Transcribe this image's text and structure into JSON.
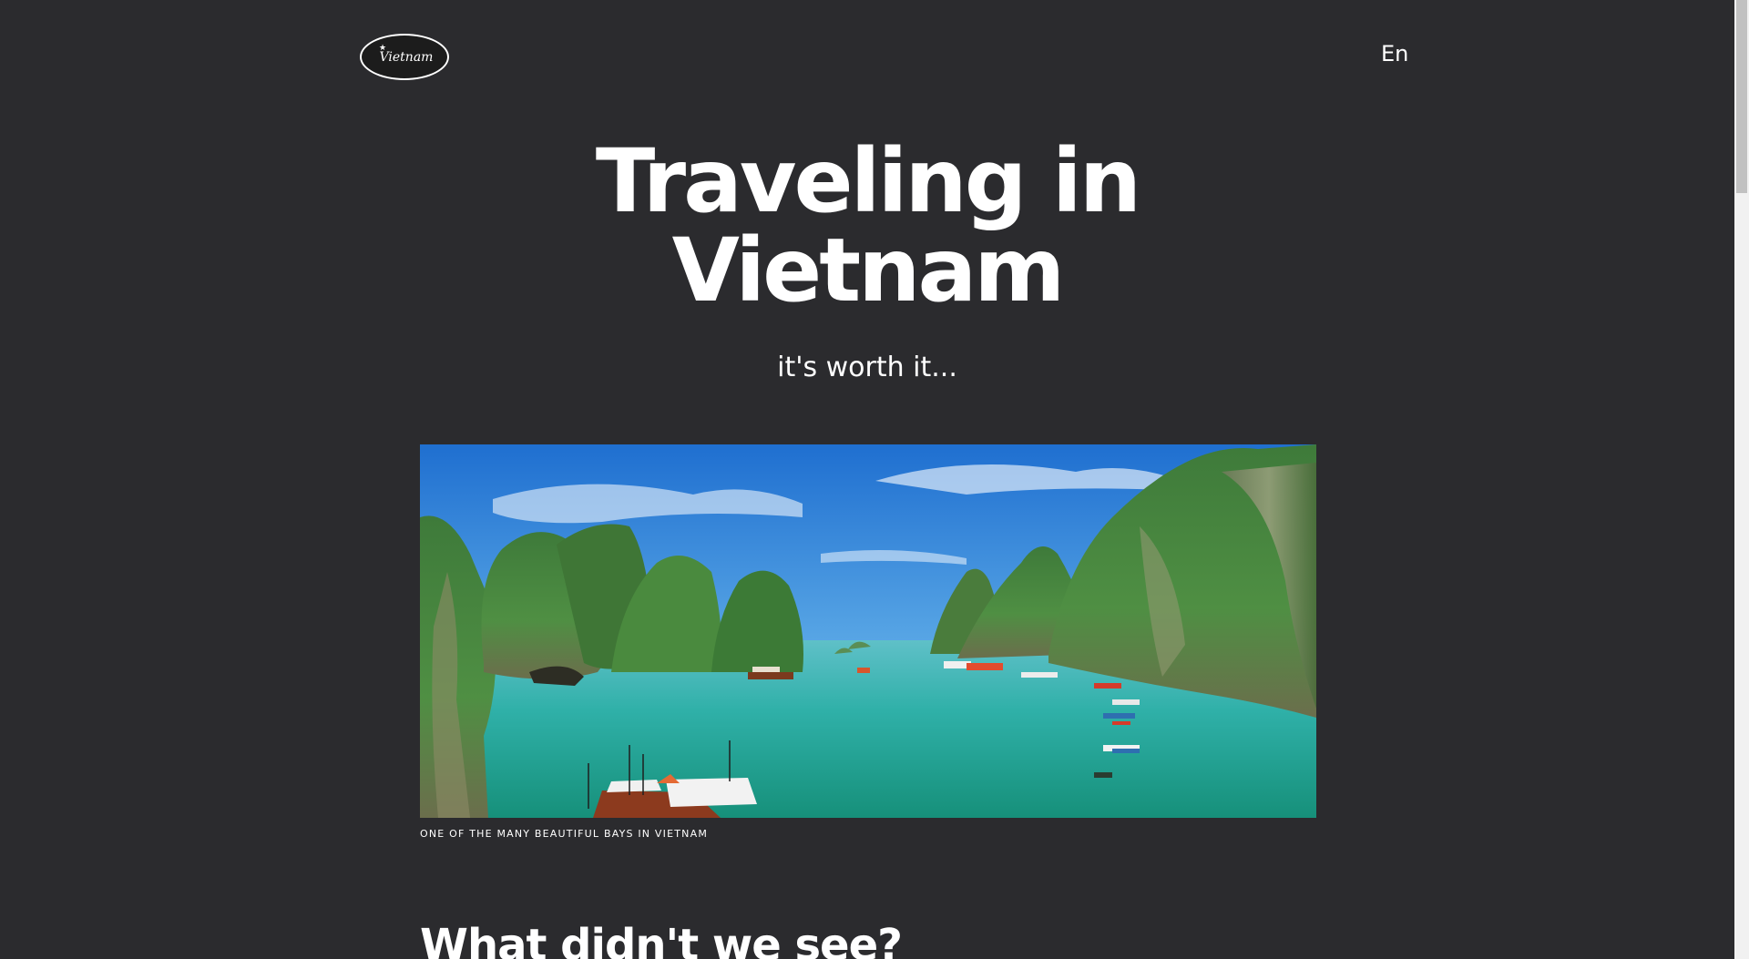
{
  "header": {
    "logo_text": "Vietnam",
    "language": "En"
  },
  "hero": {
    "title_line1": "Traveling in",
    "title_line2": "Vietnam",
    "subtitle": "it's worth it..."
  },
  "figure": {
    "image_icon": "halong-bay-photo",
    "caption": "ONE OF THE MANY BEAUTIFUL BAYS IN VIETNAM"
  },
  "section": {
    "heading": "What didn't we see?"
  },
  "colors": {
    "background": "#2b2b2e",
    "text": "#ffffff"
  }
}
